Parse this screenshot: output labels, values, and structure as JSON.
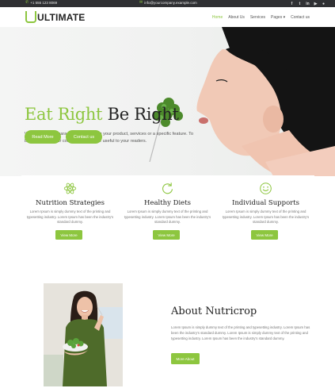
{
  "topbar": {
    "phone": "+1 555 123 8069",
    "email": "info@yourcompany.example.com",
    "socials": [
      "facebook-icon",
      "twitter-icon",
      "linkedin-icon",
      "youtube-icon",
      "github-icon"
    ]
  },
  "header": {
    "logo_letter": "U",
    "logo_text": "ULTIMATE",
    "nav": [
      {
        "label": "Home",
        "active": true
      },
      {
        "label": "About Us"
      },
      {
        "label": "Services"
      },
      {
        "label": "Pages ▾"
      },
      {
        "label": "Contact us"
      }
    ]
  },
  "hero": {
    "title_green": "Eat Right",
    "title_dark": " Be Right",
    "description": "Write one or two paragraphs describing your product, services or a specific feature. To be successful your content needs to be useful to your readers.",
    "read_more": "Read More",
    "contact_us": "Contact us"
  },
  "features": [
    {
      "icon": "atom-icon",
      "title": "Nutrition Strategies",
      "desc": "Lorem Ipsum is simply dummy text of the printing and typesetting industry. Lorem Ipsum has been the industry's standard dummy.",
      "button": "View More"
    },
    {
      "icon": "refresh-icon",
      "title": "Healthy Diets",
      "desc": "Lorem Ipsum is simply dummy text of the printing and typesetting industry. Lorem Ipsum has been the industry's standard dummy.",
      "button": "View More"
    },
    {
      "icon": "smiley-icon",
      "title": "Individual Supports",
      "desc": "Lorem Ipsum is simply dummy text of the printing and typesetting industry. Lorem Ipsum has been the industry's standard dummy.",
      "button": "View More"
    }
  ],
  "about": {
    "title": "About Nutricrop",
    "desc": "Lorem Ipsum is simply dummy text of the printing and typesetting industry. Lorem Ipsum has been the industry's standard dummy. Lorem Ipsum is simply dummy text of the printing and typesetting industry. Lorem Ipsum has been the industry's standard dummy.",
    "button": "More About"
  },
  "colors": {
    "accent": "#8dc63f",
    "topbar_bg": "#2f3033"
  }
}
